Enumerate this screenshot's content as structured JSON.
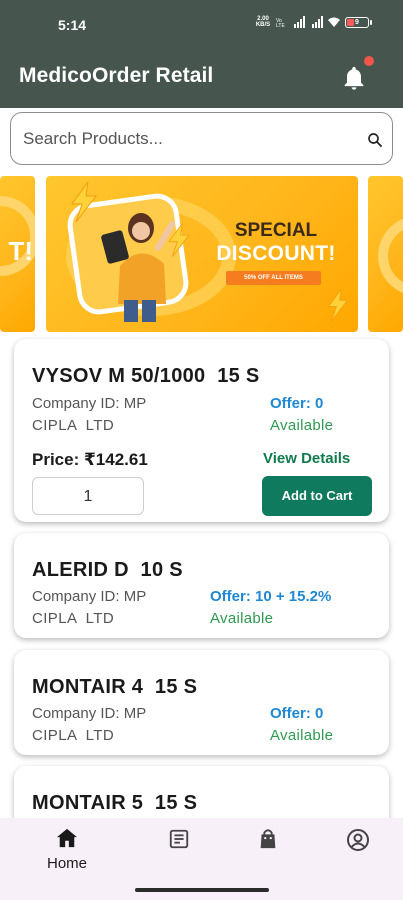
{
  "status_bar": {
    "time": "5:14",
    "net_speed_top": "2.00",
    "net_speed_bottom": "KB/S",
    "battery_level": "9"
  },
  "app": {
    "title": "MedicoOrder Retail",
    "notification_icon": "bell-icon"
  },
  "search": {
    "placeholder": "Search Products...",
    "icon": "search-icon"
  },
  "banner": {
    "title_line1": "SPECIAL",
    "title_line2": "DISCOUNT!",
    "subtitle": "50% OFF ALL ITEMS",
    "left_fragment": "T!"
  },
  "products": [
    {
      "name": "VYSOV M 50/1000  15 S",
      "company_id": "Company ID: MP",
      "manufacturer": "CIPLA  LTD",
      "offer": "Offer: 0",
      "availability": "Available",
      "price": "Price: ₹142.61",
      "view_details": "View Details",
      "quantity": "1",
      "add_to_cart": "Add to Cart"
    },
    {
      "name": "ALERID D  10 S",
      "company_id": "Company ID: MP",
      "manufacturer": "CIPLA  LTD",
      "offer": "Offer: 10 + 15.2%",
      "availability": "Available"
    },
    {
      "name": "MONTAIR 4  15 S",
      "company_id": "Company ID: MP",
      "manufacturer": "CIPLA  LTD",
      "offer": "Offer: 0",
      "availability": "Available"
    },
    {
      "name": "MONTAIR 5  15 S"
    }
  ],
  "bottom_nav": {
    "items": [
      {
        "label": "Home",
        "icon": "home-icon",
        "active": true
      },
      {
        "label": "",
        "icon": "orders-list-icon"
      },
      {
        "label": "",
        "icon": "shopping-bag-icon"
      },
      {
        "label": "",
        "icon": "profile-icon"
      }
    ]
  },
  "colors": {
    "appbar": "#46564f",
    "primary_button": "#0f7a5e",
    "offer_text": "#1e88d4",
    "available_text": "#2e9a52",
    "notification_dot": "#f0554a",
    "banner": "#ffb51a",
    "nav_background": "#f8f0f8"
  }
}
